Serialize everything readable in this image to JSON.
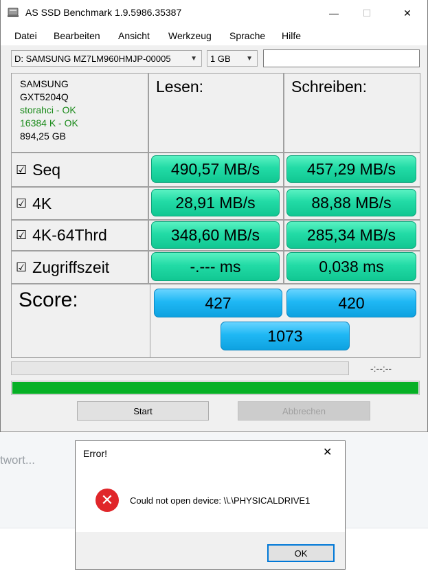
{
  "window": {
    "title": "AS SSD Benchmark 1.9.5986.35387",
    "minimize_glyph": "—",
    "maximize_glyph": "☐",
    "close_glyph": "✕"
  },
  "menu": [
    "Datei",
    "Bearbeiten",
    "Ansicht",
    "Werkzeug",
    "Sprache",
    "Hilfe"
  ],
  "toolbar": {
    "drive_select": "D: SAMSUNG MZ7LM960HMJP-00005",
    "size_select": "1 GB",
    "text_value": ""
  },
  "drive_info": {
    "vendor": "SAMSUNG",
    "firmware": "GXT5204Q",
    "driver": "storahci - OK",
    "alignment": "16384 K - OK",
    "capacity": "894,25 GB"
  },
  "columns": {
    "read": "Lesen:",
    "write": "Schreiben:"
  },
  "checkbox_glyph": "☑",
  "tests": [
    {
      "label": "Seq",
      "read": "490,57 MB/s",
      "write": "457,29 MB/s"
    },
    {
      "label": "4K",
      "read": "28,91 MB/s",
      "write": "88,88 MB/s"
    },
    {
      "label": "4K-64Thrd",
      "read": "348,60 MB/s",
      "write": "285,34 MB/s"
    },
    {
      "label": "Zugriffszeit",
      "read": "-.--- ms",
      "write": "0,038 ms"
    }
  ],
  "score": {
    "label": "Score:",
    "read": "427",
    "write": "420",
    "total": "1073"
  },
  "progress": {
    "time_text": "-:--:--",
    "overall_fraction": 1.0
  },
  "buttons": {
    "start": "Start",
    "abort": "Abbrechen"
  },
  "background": {
    "partial_text": "twort..."
  },
  "dialog": {
    "title": "Error!",
    "close_glyph": "✕",
    "icon_glyph": "✕",
    "message": "Could not open device: \\\\.\\PHYSICALDRIVE1",
    "ok": "OK"
  },
  "colors": {
    "result_green": "#22dba6",
    "score_blue": "#1fb8f4",
    "progress_green": "#06b025",
    "error_red": "#e0262a",
    "driver_ok_green": "#1a8a1a"
  }
}
